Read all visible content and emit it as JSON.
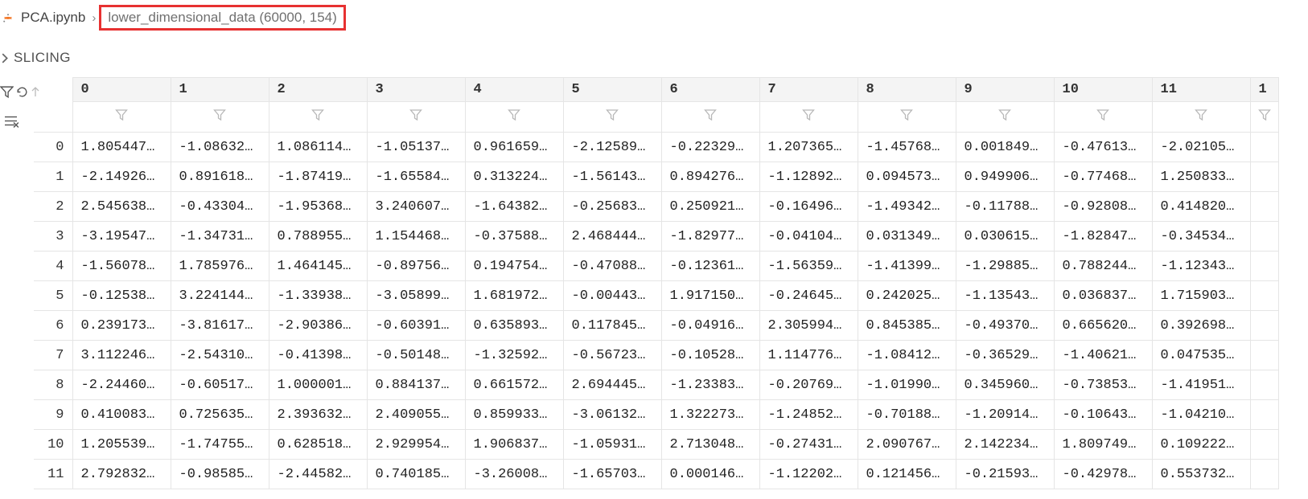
{
  "breadcrumb": {
    "file": "PCA.ipynb",
    "variable": "lower_dimensional_data (60000, 154)"
  },
  "section": {
    "title": "SLICING"
  },
  "columns": [
    "0",
    "1",
    "2",
    "3",
    "4",
    "5",
    "6",
    "7",
    "8",
    "9",
    "10",
    "11",
    "1"
  ],
  "rows": [
    {
      "idx": "0",
      "cells": [
        "1.805447…",
        "-1.08632…",
        "1.086114…",
        "-1.05137…",
        "0.961659…",
        "-2.12589…",
        "-0.22329…",
        "1.207365…",
        "-1.45768…",
        "0.001849…",
        "-0.47613…",
        "-2.02105…"
      ]
    },
    {
      "idx": "1",
      "cells": [
        "-2.14926…",
        "0.891618…",
        "-1.87419…",
        "-1.65584…",
        "0.313224…",
        "-1.56143…",
        "0.894276…",
        "-1.12892…",
        "0.094573…",
        "0.949906…",
        "-0.77468…",
        "1.250833…"
      ]
    },
    {
      "idx": "2",
      "cells": [
        "2.545638…",
        "-0.43304…",
        "-1.95368…",
        "3.240607…",
        "-1.64382…",
        "-0.25683…",
        "0.250921…",
        "-0.16496…",
        "-1.49342…",
        "-0.11788…",
        "-0.92808…",
        "0.414820…"
      ]
    },
    {
      "idx": "3",
      "cells": [
        "-3.19547…",
        "-1.34731…",
        "0.788955…",
        "1.154468…",
        "-0.37588…",
        "2.468444…",
        "-1.82977…",
        "-0.04104…",
        "0.031349…",
        "0.030615…",
        "-1.82847…",
        "-0.34534…"
      ]
    },
    {
      "idx": "4",
      "cells": [
        "-1.56078…",
        "1.785976…",
        "1.464145…",
        "-0.89756…",
        "0.194754…",
        "-0.47088…",
        "-0.12361…",
        "-1.56359…",
        "-1.41399…",
        "-1.29885…",
        "0.788244…",
        "-1.12343…"
      ]
    },
    {
      "idx": "5",
      "cells": [
        "-0.12538…",
        "3.224144…",
        "-1.33938…",
        "-3.05899…",
        "1.681972…",
        "-0.00443…",
        "1.917150…",
        "-0.24645…",
        "0.242025…",
        "-1.13543…",
        "0.036837…",
        "1.715903…"
      ]
    },
    {
      "idx": "6",
      "cells": [
        "0.239173…",
        "-3.81617…",
        "-2.90386…",
        "-0.60391…",
        "0.635893…",
        "0.117845…",
        "-0.04916…",
        "2.305994…",
        "0.845385…",
        "-0.49370…",
        "0.665620…",
        "0.392698…"
      ]
    },
    {
      "idx": "7",
      "cells": [
        "3.112246…",
        "-2.54310…",
        "-0.41398…",
        "-0.50148…",
        "-1.32592…",
        "-0.56723…",
        "-0.10528…",
        "1.114776…",
        "-1.08412…",
        "-0.36529…",
        "-1.40621…",
        "0.047535…"
      ]
    },
    {
      "idx": "8",
      "cells": [
        "-2.24460…",
        "-0.60517…",
        "1.000001…",
        "0.884137…",
        "0.661572…",
        "2.694445…",
        "-1.23383…",
        "-0.20769…",
        "-1.01990…",
        "0.345960…",
        "-0.73853…",
        "-1.41951…"
      ]
    },
    {
      "idx": "9",
      "cells": [
        "0.410083…",
        "0.725635…",
        "2.393632…",
        "2.409055…",
        "0.859933…",
        "-3.06132…",
        "1.322273…",
        "-1.24852…",
        "-0.70188…",
        "-1.20914…",
        "-0.10643…",
        "-1.04210…"
      ]
    },
    {
      "idx": "10",
      "cells": [
        "1.205539…",
        "-1.74755…",
        "0.628518…",
        "2.929954…",
        "1.906837…",
        "-1.05931…",
        "2.713048…",
        "-0.27431…",
        "2.090767…",
        "2.142234…",
        "1.809749…",
        "0.109222…"
      ]
    },
    {
      "idx": "11",
      "cells": [
        "2.792832…",
        "-0.98585…",
        "-2.44582…",
        "0.740185…",
        "-3.26008…",
        "-1.65703…",
        "0.000146…",
        "-1.12202…",
        "0.121456…",
        "-0.21593…",
        "-0.42978…",
        "0.553732…"
      ]
    }
  ]
}
